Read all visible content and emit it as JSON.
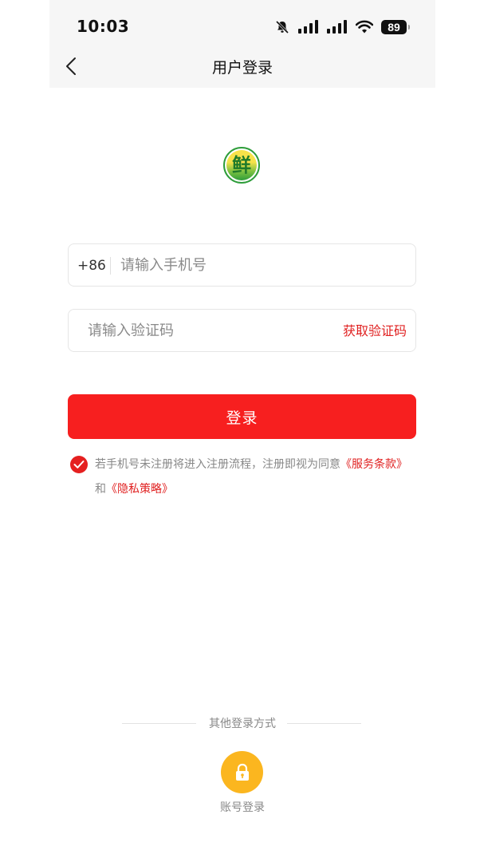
{
  "status_bar": {
    "time": "10:03",
    "battery": "89"
  },
  "header": {
    "title": "用户登录"
  },
  "logo": {
    "glyph": "鲜"
  },
  "phone_field": {
    "prefix": "+86",
    "placeholder": "请输入手机号",
    "value": ""
  },
  "code_field": {
    "placeholder": "请输入验证码",
    "value": "",
    "get_code_label": "获取验证码"
  },
  "login_button": {
    "label": "登录"
  },
  "agreement": {
    "checked": true,
    "text_prefix": "若手机号未注册将进入注册流程，注册即视为同意",
    "terms_link": "《服务条款》",
    "joiner": "和",
    "privacy_link": "《隐私策略》"
  },
  "other_login": {
    "title": "其他登录方式",
    "account_label": "账号登录",
    "account_icon": "lock-icon"
  },
  "colors": {
    "accent": "#f71f1f",
    "link": "#e02020",
    "account_button": "#fbb61f"
  }
}
